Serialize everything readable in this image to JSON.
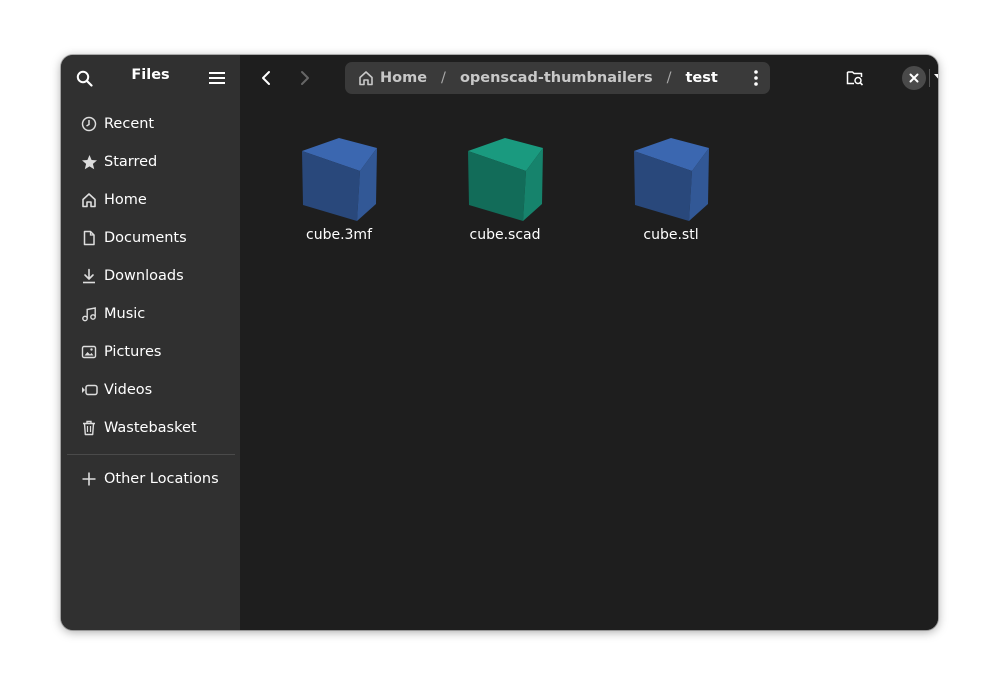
{
  "sidebar": {
    "title": "Files",
    "items": [
      {
        "label": "Recent",
        "icon": "clock-icon"
      },
      {
        "label": "Starred",
        "icon": "star-icon"
      },
      {
        "label": "Home",
        "icon": "home-icon"
      },
      {
        "label": "Documents",
        "icon": "document-icon"
      },
      {
        "label": "Downloads",
        "icon": "download-icon"
      },
      {
        "label": "Music",
        "icon": "music-icon"
      },
      {
        "label": "Pictures",
        "icon": "picture-icon"
      },
      {
        "label": "Videos",
        "icon": "video-icon"
      },
      {
        "label": "Wastebasket",
        "icon": "trash-icon"
      }
    ],
    "other_locations": "Other Locations"
  },
  "path": {
    "segments": [
      "Home",
      "openscad-thumbnailers",
      "test"
    ],
    "separator": "/"
  },
  "files": [
    {
      "name": "cube.3mf",
      "color": "#3b67b0"
    },
    {
      "name": "cube.scad",
      "color": "#1a9a7f"
    },
    {
      "name": "cube.stl",
      "color": "#3b67b0"
    }
  ],
  "colors": {
    "window_bg": "#1e1e1e",
    "sidebar_bg": "#303030",
    "pathbar_bg": "#3a3a3a"
  }
}
